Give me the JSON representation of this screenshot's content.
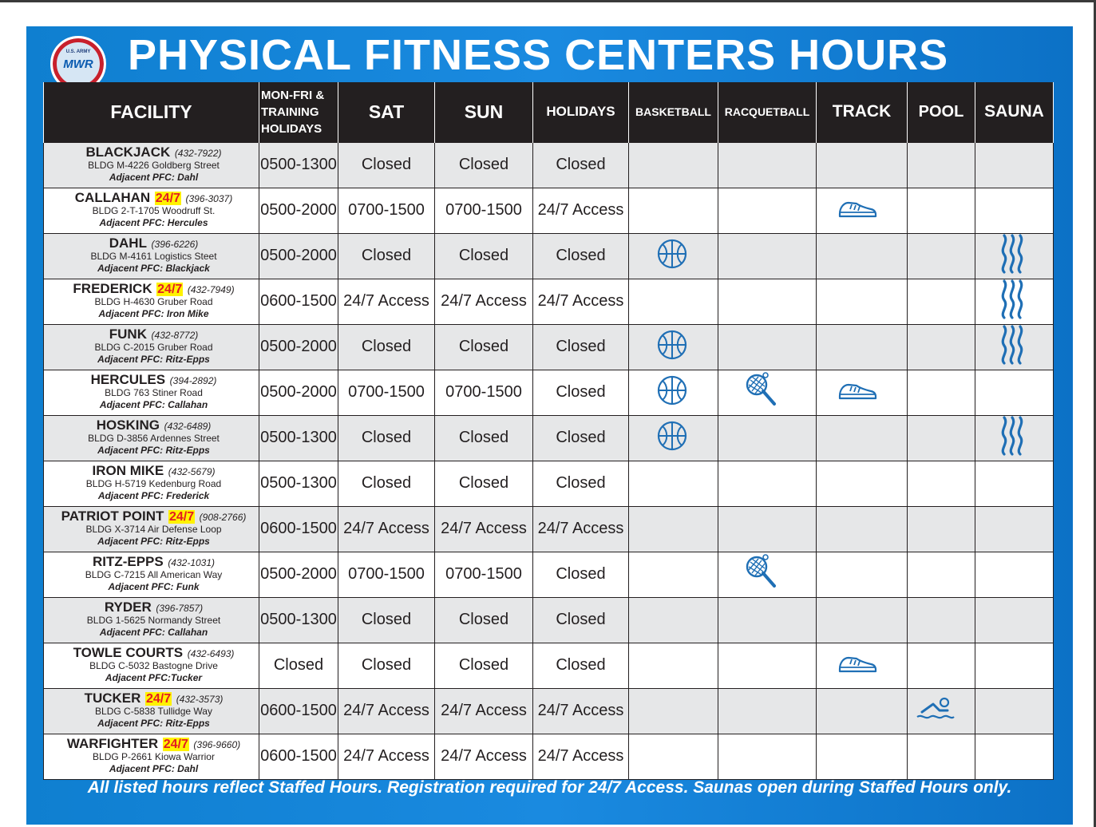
{
  "logo": {
    "top_text": "U.S. ARMY",
    "name": "MWR"
  },
  "title": "PHYSICAL FITNESS CENTERS HOURS",
  "headers": {
    "facility": "FACILITY",
    "monfri_line1": "MON-FRI &",
    "monfri_line2": "TRAINING",
    "monfri_line3": "HOLIDAYS",
    "sat": "SAT",
    "sun": "SUN",
    "holidays": "HOLIDAYS",
    "basketball": "BASKETBALL",
    "racquetball": "RACQUETBALL",
    "track": "TRACK",
    "pool": "POOL",
    "sauna": "SAUNA"
  },
  "amenity_icons": {
    "basketball": "basketball-icon",
    "racquetball": "racquet-icon",
    "track": "sneaker-icon",
    "pool": "swimmer-icon",
    "sauna": "steam-waves-icon"
  },
  "colors": {
    "panel_blue": "#1a8ae0",
    "header_black": "#231f20",
    "row_shade": "#e6e7e8",
    "badge_red": "#e31b23",
    "badge_yellow": "#fff200",
    "icon_blue": "#1f6fb5"
  },
  "facilities": [
    {
      "name": "BLACKJACK",
      "badge": "",
      "phone": "(432-7922)",
      "address": "BLDG M-4226 Goldberg Street",
      "adjacent": "Adjacent PFC: Dahl",
      "monfri": "0500-1300",
      "sat": "Closed",
      "sun": "Closed",
      "holidays": "Closed",
      "basketball": false,
      "racquetball": false,
      "track": false,
      "pool": false,
      "sauna": false
    },
    {
      "name": "CALLAHAN",
      "badge": "24/7",
      "phone": "(396-3037)",
      "address": "BLDG 2-T-1705 Woodruff St.",
      "adjacent": "Adjacent PFC: Hercules",
      "monfri": "0500-2000",
      "sat": "0700-1500",
      "sun": "0700-1500",
      "holidays": "24/7 Access",
      "basketball": false,
      "racquetball": false,
      "track": true,
      "pool": false,
      "sauna": false
    },
    {
      "name": "DAHL",
      "badge": "",
      "phone": "(396-6226)",
      "address": "BLDG M-4161 Logistics Steet",
      "adjacent": "Adjacent PFC: Blackjack",
      "monfri": "0500-2000",
      "sat": "Closed",
      "sun": "Closed",
      "holidays": "Closed",
      "basketball": true,
      "racquetball": false,
      "track": false,
      "pool": false,
      "sauna": true
    },
    {
      "name": "FREDERICK",
      "badge": "24/7",
      "phone": "(432-7949)",
      "address": "BLDG H-4630 Gruber Road",
      "adjacent": "Adjacent PFC: Iron Mike",
      "monfri": "0600-1500",
      "sat": "24/7 Access",
      "sun": "24/7 Access",
      "holidays": "24/7 Access",
      "basketball": false,
      "racquetball": false,
      "track": false,
      "pool": false,
      "sauna": true
    },
    {
      "name": "FUNK",
      "badge": "",
      "phone": "(432-8772)",
      "address": "BLDG C-2015 Gruber Road",
      "adjacent": "Adjacent PFC: Ritz-Epps",
      "monfri": "0500-2000",
      "sat": "Closed",
      "sun": "Closed",
      "holidays": "Closed",
      "basketball": true,
      "racquetball": false,
      "track": false,
      "pool": false,
      "sauna": true
    },
    {
      "name": "HERCULES",
      "badge": "",
      "phone": "(394-2892)",
      "address": "BLDG 763 Stiner Road",
      "adjacent": "Adjacent PFC: Callahan",
      "monfri": "0500-2000",
      "sat": "0700-1500",
      "sun": "0700-1500",
      "holidays": "Closed",
      "basketball": true,
      "racquetball": true,
      "track": true,
      "pool": false,
      "sauna": false
    },
    {
      "name": "HOSKING",
      "badge": "",
      "phone": "(432-6489)",
      "address": "BLDG D-3856 Ardennes Street",
      "adjacent": "Adjacent PFC: Ritz-Epps",
      "monfri": "0500-1300",
      "sat": "Closed",
      "sun": "Closed",
      "holidays": "Closed",
      "basketball": true,
      "racquetball": false,
      "track": false,
      "pool": false,
      "sauna": true
    },
    {
      "name": "IRON MIKE",
      "badge": "",
      "phone": "(432-5679)",
      "address": "BLDG H-5719 Kedenburg Road",
      "adjacent": "Adjacent PFC: Frederick",
      "monfri": "0500-1300",
      "sat": "Closed",
      "sun": "Closed",
      "holidays": "Closed",
      "basketball": false,
      "racquetball": false,
      "track": false,
      "pool": false,
      "sauna": false
    },
    {
      "name": "PATRIOT POINT",
      "badge": "24/7",
      "phone": "(908-2766)",
      "address": "BLDG X-3714 Air Defense Loop",
      "adjacent": "Adjacent PFC: Ritz-Epps",
      "monfri": "0600-1500",
      "sat": "24/7 Access",
      "sun": "24/7 Access",
      "holidays": "24/7 Access",
      "basketball": false,
      "racquetball": false,
      "track": false,
      "pool": false,
      "sauna": false
    },
    {
      "name": "RITZ-EPPS",
      "badge": "",
      "phone": "(432-1031)",
      "address": "BLDG C-7215 All American Way",
      "adjacent": "Adjacent PFC: Funk",
      "monfri": "0500-2000",
      "sat": "0700-1500",
      "sun": "0700-1500",
      "holidays": "Closed",
      "basketball": false,
      "racquetball": true,
      "track": false,
      "pool": false,
      "sauna": false
    },
    {
      "name": "RYDER",
      "badge": "",
      "phone": "(396-7857)",
      "address": "BLDG 1-5625 Normandy Street",
      "adjacent": "Adjacent PFC: Callahan",
      "monfri": "0500-1300",
      "sat": "Closed",
      "sun": "Closed",
      "holidays": "Closed",
      "basketball": false,
      "racquetball": false,
      "track": false,
      "pool": false,
      "sauna": false
    },
    {
      "name": "TOWLE COURTS",
      "badge": "",
      "phone": "(432-6493)",
      "address": "BLDG C-5032 Bastogne Drive",
      "adjacent": "Adjacent PFC:Tucker",
      "monfri": "Closed",
      "sat": "Closed",
      "sun": "Closed",
      "holidays": "Closed",
      "basketball": false,
      "racquetball": false,
      "track": true,
      "pool": false,
      "sauna": false
    },
    {
      "name": "TUCKER",
      "badge": "24/7",
      "phone": "(432-3573)",
      "address": "BLDG C-5838 Tullidge Way",
      "adjacent": "Adjacent PFC: Ritz-Epps",
      "monfri": "0600-1500",
      "sat": "24/7 Access",
      "sun": "24/7 Access",
      "holidays": "24/7 Access",
      "basketball": false,
      "racquetball": false,
      "track": false,
      "pool": true,
      "sauna": false
    },
    {
      "name": "WARFIGHTER",
      "badge": "24/7",
      "phone": "(396-9660)",
      "address": "BLDG P-2661 Kiowa Warrior",
      "adjacent": "Adjacent PFC: Dahl",
      "monfri": "0600-1500",
      "sat": "24/7 Access",
      "sun": "24/7 Access",
      "holidays": "24/7 Access",
      "basketball": false,
      "racquetball": false,
      "track": false,
      "pool": false,
      "sauna": false
    }
  ],
  "footer": "All listed hours reflect Staffed Hours. Registration required for 24/7 Access. Saunas open during Staffed Hours only."
}
